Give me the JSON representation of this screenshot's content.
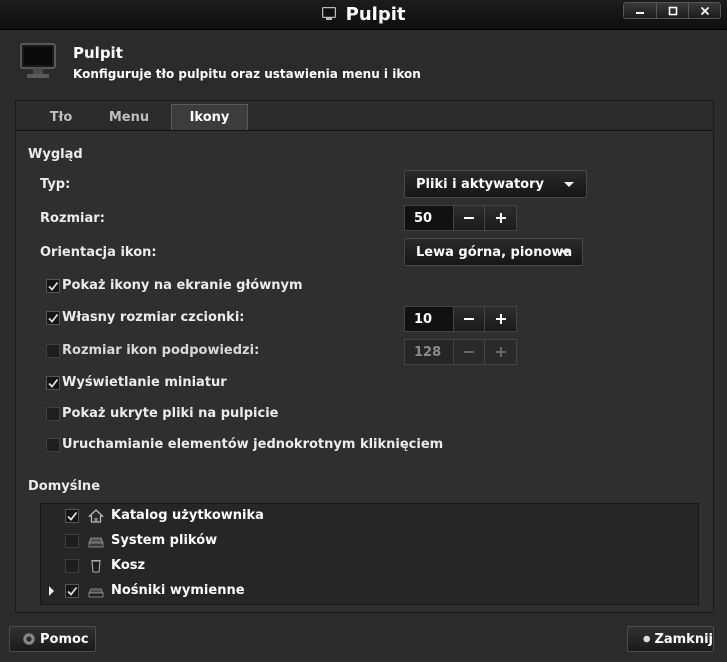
{
  "window": {
    "title": "Pulpit"
  },
  "header": {
    "title": "Pulpit",
    "subtitle": "Konfiguruje tło pulpitu oraz ustawienia menu i ikon"
  },
  "tabs": [
    {
      "label": "Tło",
      "active": false
    },
    {
      "label": "Menu",
      "active": false
    },
    {
      "label": "Ikony",
      "active": true
    }
  ],
  "appearance": {
    "section": "Wygląd",
    "type_label": "Typ:",
    "type_value": "Pliki i aktywatory",
    "size_label": "Rozmiar:",
    "size_value": "50",
    "orientation_label": "Orientacja ikon:",
    "orientation_value": "Lewa górna, pionowa",
    "options": [
      {
        "label": "Pokaż ikony na ekranie głównym",
        "checked": true
      },
      {
        "label": "Własny rozmiar czcionki:",
        "checked": true,
        "spin_value": "10",
        "enabled": true
      },
      {
        "label": "Rozmiar ikon podpowiedzi:",
        "checked": false,
        "spin_value": "128",
        "enabled": false
      },
      {
        "label": "Wyświetlanie miniatur",
        "checked": true
      },
      {
        "label": "Pokaż ukryte pliki na pulpicie",
        "checked": false
      },
      {
        "label": "Uruchamianie elementów jednokrotnym kliknięciem",
        "checked": false
      }
    ]
  },
  "defaults": {
    "section": "Domyślne",
    "items": [
      {
        "label": "Katalog użytkownika",
        "checked": true,
        "icon": "home-icon"
      },
      {
        "label": "System plików",
        "checked": false,
        "icon": "drive-icon"
      },
      {
        "label": "Kosz",
        "checked": false,
        "icon": "trash-icon"
      },
      {
        "label": "Nośniki wymienne",
        "checked": true,
        "icon": "removable-drive-icon"
      }
    ]
  },
  "footer": {
    "help_label": "Pomoc",
    "close_label": "Zamknij"
  },
  "colors": {
    "background": "#2b2b2b",
    "titlebar": "#111111",
    "text": "#ececec"
  }
}
